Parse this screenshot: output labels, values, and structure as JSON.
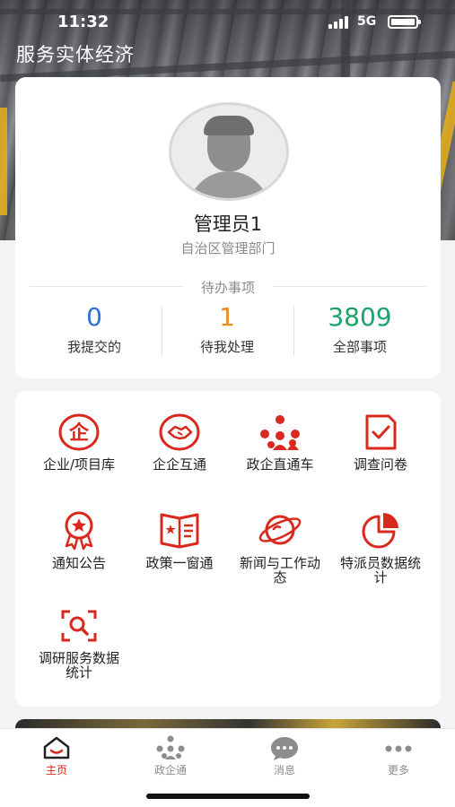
{
  "status_bar": {
    "time": "11:32",
    "network": "5G"
  },
  "header": {
    "title": "服务实体经济"
  },
  "profile": {
    "name": "管理员1",
    "department": "自治区管理部门",
    "todo_title": "待办事项",
    "stats": [
      {
        "value": "0",
        "label": "我提交的",
        "color": "#2f6fd6"
      },
      {
        "value": "1",
        "label": "待我处理",
        "color": "#f08a1c"
      },
      {
        "value": "3809",
        "label": "全部事项",
        "color": "#1aa36a"
      }
    ]
  },
  "functions": [
    {
      "label": "企业/项目库",
      "icon": "enterprise-icon"
    },
    {
      "label": "企企互通",
      "icon": "handshake-icon"
    },
    {
      "label": "政企直通车",
      "icon": "network-icon"
    },
    {
      "label": "调查问卷",
      "icon": "survey-icon"
    },
    {
      "label": "通知公告",
      "icon": "badge-icon"
    },
    {
      "label": "政策一窗通",
      "icon": "policy-book-icon"
    },
    {
      "label": "新闻与工作动态",
      "icon": "planet-icon"
    },
    {
      "label": "特派员数据统计",
      "icon": "pie-chart-icon"
    },
    {
      "label": "调研服务数据统计",
      "icon": "scan-search-icon"
    }
  ],
  "tabbar": [
    {
      "label": "主页",
      "icon": "home-icon",
      "active": true
    },
    {
      "label": "政企通",
      "icon": "network-icon",
      "active": false
    },
    {
      "label": "消息",
      "icon": "chat-icon",
      "active": false
    },
    {
      "label": "更多",
      "icon": "more-icon",
      "active": false
    }
  ],
  "colors": {
    "accent": "#d9281e",
    "card": "#ffffff",
    "background": "#f2f3f5"
  }
}
